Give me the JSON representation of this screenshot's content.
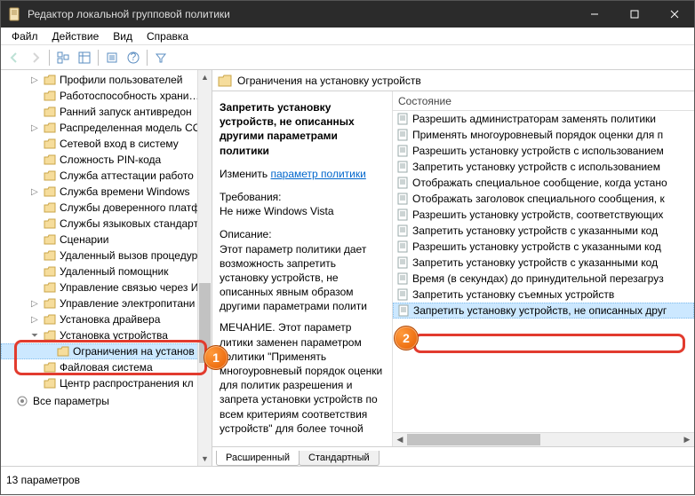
{
  "window": {
    "title": "Редактор локальной групповой политики"
  },
  "menu": {
    "file": "Файл",
    "action": "Действие",
    "view": "Вид",
    "help": "Справка"
  },
  "tree": {
    "items": [
      {
        "chev": "▷",
        "label": "Профили пользователей"
      },
      {
        "chev": "",
        "label": "Работоспособность храни…"
      },
      {
        "chev": "",
        "label": "Ранний запуск антивредон"
      },
      {
        "chev": "▷",
        "label": "Распределенная модель CO"
      },
      {
        "chev": "",
        "label": "Сетевой вход в систему"
      },
      {
        "chev": "",
        "label": "Сложность PIN-кода"
      },
      {
        "chev": "",
        "label": "Служба аттестации работо"
      },
      {
        "chev": "▷",
        "label": "Служба времени Windows"
      },
      {
        "chev": "",
        "label": "Службы доверенного платф"
      },
      {
        "chev": "",
        "label": "Службы языковых стандарт"
      },
      {
        "chev": "",
        "label": "Сценарии"
      },
      {
        "chev": "",
        "label": "Удаленный вызов процедур"
      },
      {
        "chev": "",
        "label": "Удаленный помощник"
      },
      {
        "chev": "",
        "label": "Управление связью через И"
      },
      {
        "chev": "▷",
        "label": "Управление электропитани"
      },
      {
        "chev": "▷",
        "label": "Установка драйвера"
      },
      {
        "chev": "⏷",
        "label": "Установка устройства"
      },
      {
        "chev": "",
        "label": "Ограничения на установ",
        "level": 3,
        "selected": true
      },
      {
        "chev": "",
        "label": "Файловая система"
      },
      {
        "chev": "",
        "label": "Центр распространения кл"
      }
    ],
    "root": {
      "label": "Все параметры"
    }
  },
  "content": {
    "header": "Ограничения на установку устройств",
    "desc": {
      "policy_name": "Запретить установку устройств, не описанных другими параметрами политики",
      "change_label": "Изменить",
      "change_link": "параметр политики",
      "req_label": "Требования:",
      "req_value": "Не ниже Windows Vista",
      "desc_label": "Описание:",
      "desc_body": "Этот параметр политики дает возможность запретить установку устройств, не описанных явным образом другими параметрами полити",
      "note": "МЕЧАНИЕ. Этот параметр литики заменен параметром политики \"Применять многоуровневый порядок оценки для политик разрешения и запрета установки устройств по всем критериям соответствия устройств\" для более точной"
    },
    "list": {
      "header": "Состояние",
      "items": [
        "Разрешить администраторам заменять политики",
        "Применять многоуровневый порядок оценки для п",
        "Разрешить установку устройств с использованием",
        "Запретить установку устройств с использованием",
        "Отображать специальное сообщение, когда устано",
        "Отображать заголовок специального сообщения, к",
        "Разрешить установку устройств, соответствующих",
        "Запретить установку устройств с указанными код",
        "Разрешить установку устройств с указанными код",
        "Запретить установку устройств с указанными код",
        "Время (в секундах) до принудительной перезагруз",
        "Запретить установку съемных устройств",
        "Запретить установку устройств, не описанных друг"
      ]
    },
    "tabs": {
      "extended": "Расширенный",
      "standard": "Стандартный"
    }
  },
  "status": {
    "text": "13 параметров"
  },
  "badges": {
    "b1": "1",
    "b2": "2"
  }
}
